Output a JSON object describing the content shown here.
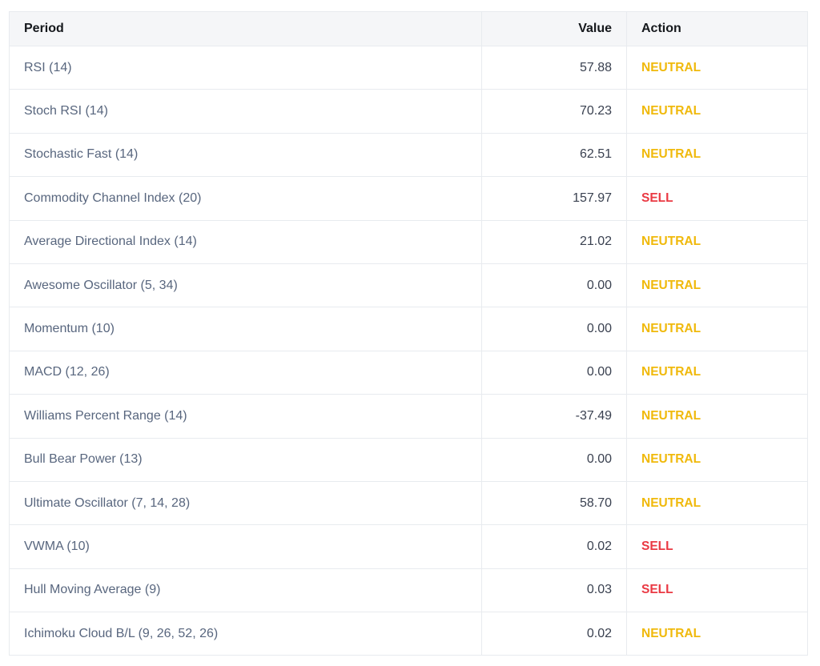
{
  "table": {
    "headers": {
      "period": "Period",
      "value": "Value",
      "action": "Action"
    },
    "action_colors": {
      "NEUTRAL": "#f0b90b",
      "SELL": "#ea3943"
    },
    "rows": [
      {
        "period": "RSI (14)",
        "value": "57.88",
        "action": "NEUTRAL"
      },
      {
        "period": "Stoch RSI (14)",
        "value": "70.23",
        "action": "NEUTRAL"
      },
      {
        "period": "Stochastic Fast (14)",
        "value": "62.51",
        "action": "NEUTRAL"
      },
      {
        "period": "Commodity Channel Index (20)",
        "value": "157.97",
        "action": "SELL"
      },
      {
        "period": "Average Directional Index (14)",
        "value": "21.02",
        "action": "NEUTRAL"
      },
      {
        "period": "Awesome Oscillator (5, 34)",
        "value": "0.00",
        "action": "NEUTRAL"
      },
      {
        "period": "Momentum (10)",
        "value": "0.00",
        "action": "NEUTRAL"
      },
      {
        "period": "MACD (12, 26)",
        "value": "0.00",
        "action": "NEUTRAL"
      },
      {
        "period": "Williams Percent Range (14)",
        "value": "-37.49",
        "action": "NEUTRAL"
      },
      {
        "period": "Bull Bear Power (13)",
        "value": "0.00",
        "action": "NEUTRAL"
      },
      {
        "period": "Ultimate Oscillator (7, 14, 28)",
        "value": "58.70",
        "action": "NEUTRAL"
      },
      {
        "period": "VWMA (10)",
        "value": "0.02",
        "action": "SELL"
      },
      {
        "period": "Hull Moving Average (9)",
        "value": "0.03",
        "action": "SELL"
      },
      {
        "period": "Ichimoku Cloud B/L (9, 26, 52, 26)",
        "value": "0.02",
        "action": "NEUTRAL"
      }
    ]
  }
}
